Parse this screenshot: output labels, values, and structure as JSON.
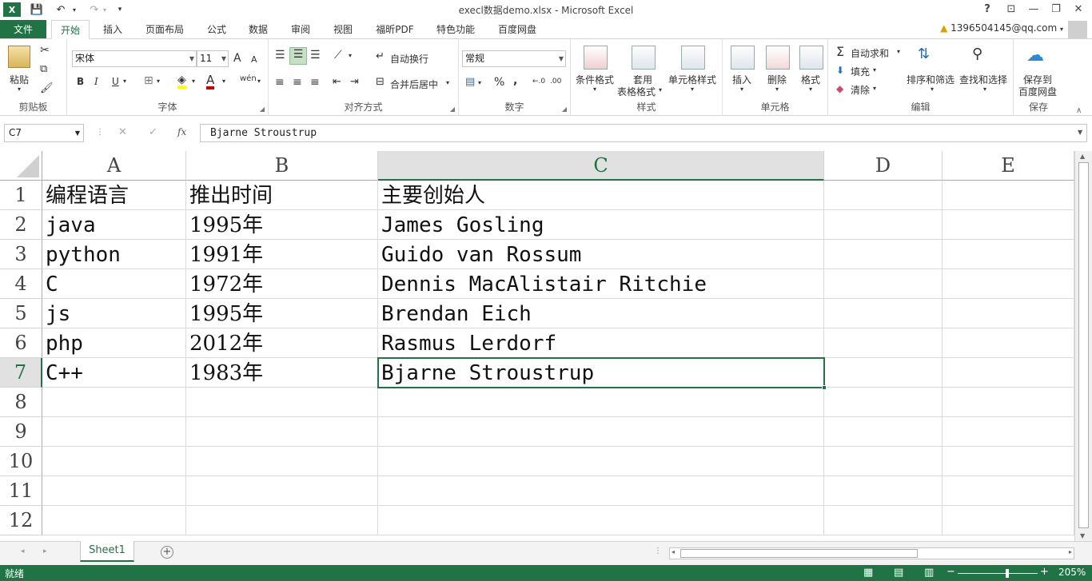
{
  "window": {
    "title": "execl数据demo.xlsx - Microsoft Excel",
    "help": "?",
    "controls": [
      "⊡",
      "—",
      "❐",
      "✕"
    ]
  },
  "quick_access": {
    "undo": "↶",
    "redo": "↷",
    "more": "▾"
  },
  "ribbon_tabs": [
    {
      "label": "文件"
    },
    {
      "label": "开始"
    },
    {
      "label": "插入"
    },
    {
      "label": "页面布局"
    },
    {
      "label": "公式"
    },
    {
      "label": "数据"
    },
    {
      "label": "审阅"
    },
    {
      "label": "视图"
    },
    {
      "label": "福昕PDF"
    },
    {
      "label": "特色功能"
    },
    {
      "label": "百度网盘"
    }
  ],
  "user": {
    "account": "1396504145@qq.com"
  },
  "ribbon": {
    "clipboard": {
      "label": "剪贴板",
      "paste": "粘贴"
    },
    "font": {
      "label": "字体",
      "font_name": "宋体",
      "font_size": "11",
      "bold": "B",
      "italic": "I",
      "underline": "U",
      "grow": "A",
      "shrink": "A",
      "phonetic": "wén"
    },
    "alignment": {
      "label": "对齐方式",
      "wrap_text": "自动换行",
      "merge_center": "合并后居中"
    },
    "number": {
      "label": "数字",
      "format": "常规",
      "percent": "%",
      "comma": ",",
      "inc_decimal": "←.0",
      "dec_decimal": ".00"
    },
    "styles": {
      "label": "样式",
      "conditional": "条件格式",
      "table_format_1": "套用",
      "table_format_2": "表格格式",
      "cell_styles": "单元格样式"
    },
    "cells": {
      "label": "单元格",
      "insert": "插入",
      "delete": "删除",
      "format": "格式"
    },
    "editing": {
      "label": "编辑",
      "autosum": "自动求和",
      "fill": "填充",
      "clear": "清除",
      "sort_filter": "排序和筛选",
      "find_select": "查找和选择"
    },
    "save": {
      "label": "保存",
      "save_to_1": "保存到",
      "save_to_2": "百度网盘"
    }
  },
  "formula_bar": {
    "name_box": "C7",
    "cancel": "✕",
    "enter": "✓",
    "fx": "fx",
    "content": "Bjarne Stroustrup"
  },
  "grid": {
    "columns": [
      "A",
      "B",
      "C",
      "D",
      "E"
    ],
    "selected_column": "C",
    "selected_row": "7",
    "row_numbers": [
      "1",
      "2",
      "3",
      "4",
      "5",
      "6",
      "7",
      "8",
      "9",
      "10",
      "11",
      "12"
    ],
    "rows": [
      [
        "编程语言",
        "推出时间",
        "主要创始人"
      ],
      [
        "java",
        "1995年",
        "James Gosling"
      ],
      [
        "python",
        "1991年",
        "Guido van Rossum"
      ],
      [
        "C",
        "1972年",
        "Dennis MacAlistair Ritchie"
      ],
      [
        "js",
        "1995年",
        "Brendan Eich"
      ],
      [
        "php",
        "2012年",
        "Rasmus Lerdorf"
      ],
      [
        "C++",
        "1983年",
        "Bjarne Stroustrup"
      ]
    ]
  },
  "sheets": {
    "active": "Sheet1",
    "add": "+"
  },
  "status_bar": {
    "state": "就绪",
    "zoom": "205%",
    "zoom_out": "−",
    "zoom_in": "+",
    "zoom_level": 0.62
  }
}
